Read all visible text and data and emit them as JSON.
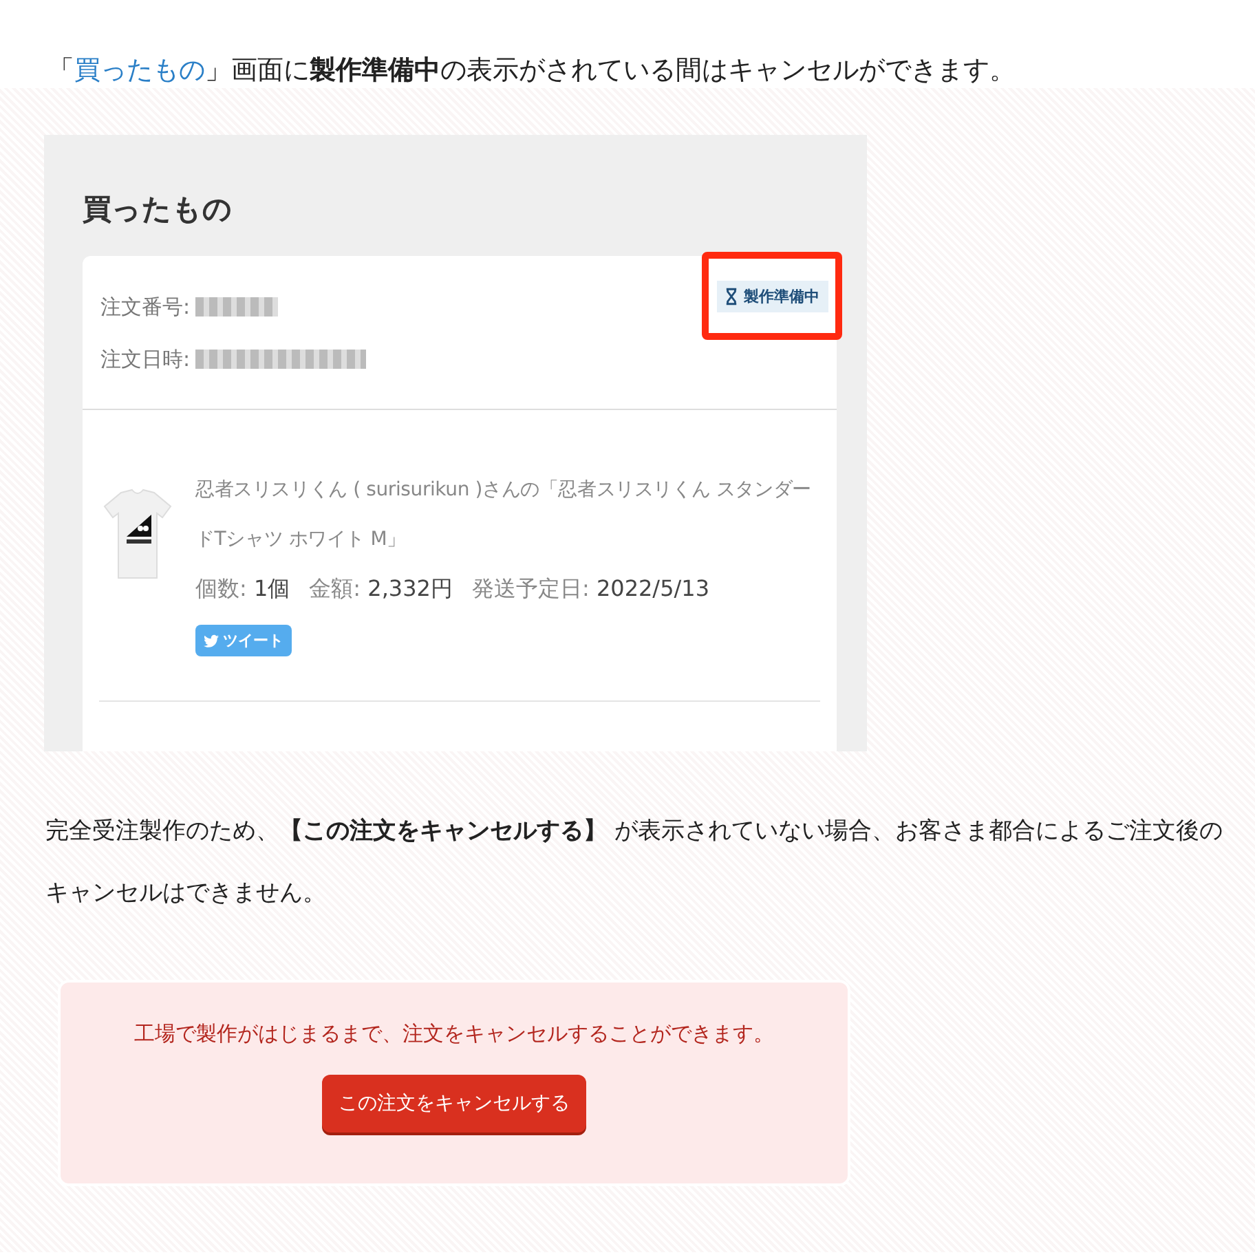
{
  "intro": [
    {
      "text": "「",
      "kind": "plain"
    },
    {
      "text": "買ったもの",
      "kind": "link"
    },
    {
      "text": "」画面に",
      "kind": "plain"
    },
    {
      "text": "製作準備中",
      "kind": "bold"
    },
    {
      "text": "の表示がされている間はキャンセルができます。",
      "kind": "plain"
    }
  ],
  "screenshot": {
    "title": "買ったもの",
    "order": {
      "number_label": "注文番号:",
      "date_label": "注文日時:",
      "status": "製作準備中",
      "status_highlighted": true
    },
    "item": {
      "description": "忍者スリスリくん ( surisurikun )さんの「忍者スリスリくん スタンダードTシャツ ホワイト M」",
      "details": [
        {
          "label": "個数:",
          "value": "1個"
        },
        {
          "label": "金額:",
          "value": "2,332円"
        },
        {
          "label": "発送予定日:",
          "value": "2022/5/13"
        }
      ],
      "tweet_button": "ツイート"
    }
  },
  "note": "完全受注製作のため、**【この注文をキャンセルする】** が表示されていない場合、お客さま都合によるご注文後のキャンセルはできません。",
  "cancel_box": {
    "message": "工場で製作がはじまるまで、注文をキャンセルすることができます。",
    "button": "この注文をキャンセルする"
  }
}
